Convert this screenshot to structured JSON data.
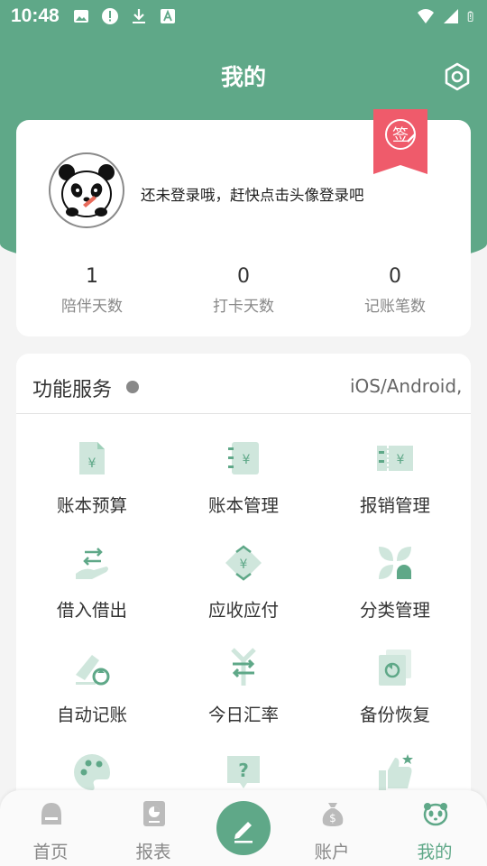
{
  "status_bar": {
    "time": "10:48",
    "left_icons": [
      "image-icon",
      "alert-icon",
      "download-icon",
      "a-notification-icon"
    ],
    "right_icons": [
      "wifi-icon",
      "signal-icon",
      "battery-icon"
    ]
  },
  "header": {
    "title": "我的",
    "settings_icon": "settings-icon"
  },
  "profile": {
    "hint": "还未登录哦，赶快点击头像登录吧",
    "badge_text": "签",
    "stats": [
      {
        "value": "1",
        "label": "陪伴天数"
      },
      {
        "value": "0",
        "label": "打卡天数"
      },
      {
        "value": "0",
        "label": "记账笔数"
      }
    ]
  },
  "services": {
    "title": "功能服务",
    "marquee": "iOS/Android,",
    "items": [
      {
        "label": "账本预算",
        "icon": "budget-icon"
      },
      {
        "label": "账本管理",
        "icon": "ledger-icon"
      },
      {
        "label": "报销管理",
        "icon": "reimburse-icon"
      },
      {
        "label": "借入借出",
        "icon": "lend-borrow-icon"
      },
      {
        "label": "应收应付",
        "icon": "receivable-icon"
      },
      {
        "label": "分类管理",
        "icon": "category-icon"
      },
      {
        "label": "自动记账",
        "icon": "auto-record-icon"
      },
      {
        "label": "今日汇率",
        "icon": "exchange-rate-icon"
      },
      {
        "label": "备份恢复",
        "icon": "backup-icon"
      },
      {
        "label": "",
        "icon": "palette-icon"
      },
      {
        "label": "",
        "icon": "help-icon"
      },
      {
        "label": "",
        "icon": "thumbs-up-icon"
      }
    ]
  },
  "tabbar": {
    "tabs": [
      {
        "label": "首页",
        "icon": "home-icon"
      },
      {
        "label": "报表",
        "icon": "report-icon"
      },
      {
        "label": "账户",
        "icon": "money-bag-icon"
      },
      {
        "label": "我的",
        "icon": "panda-icon"
      }
    ],
    "fab_icon": "pencil-icon"
  },
  "colors": {
    "accent": "#5fa888",
    "icon_light": "#cfe6dc",
    "badge": "#ef5b6b"
  }
}
